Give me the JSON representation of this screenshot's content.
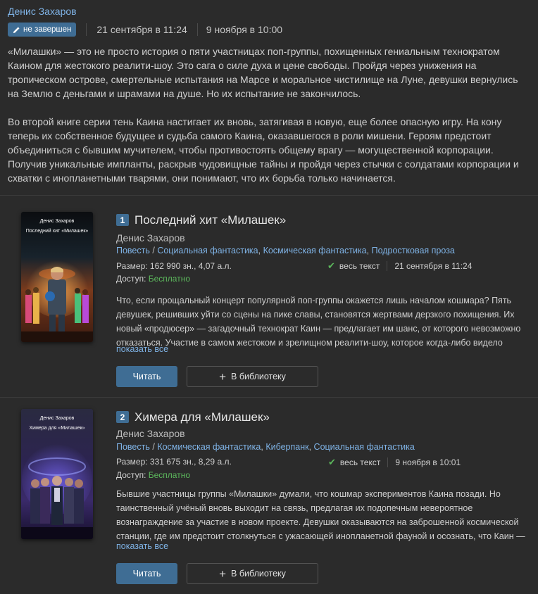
{
  "series": {
    "author": "Денис Захаров",
    "status_badge": "не завершен",
    "created": "21 сентября в 11:24",
    "updated": "9 ноября в 10:00",
    "description": [
      "«Милашки» — это не просто история о пяти участницах поп-группы, похищенных гениальным технократом Каином для жестокого реалити-шоу. Это сага о силе духа и цене свободы. Пройдя через унижения на тропическом острове, смертельные испытания на Марсе и моральное чистилище на Луне, девушки вернулись на Землю с деньгами и шрамами на душе. Но их испытание не закончилось.",
      "Во второй книге серии тень Каина настигает их вновь, затягивая в новую, еще более опасную игру. На кону теперь их собственное будущее и судьба самого Каина, оказавшегося в роли мишени. Героям предстоит объединиться с бывшим мучителем, чтобы противостоять общему врагу — могущественной корпорации. Получив уникальные импланты, раскрыв чудовищные тайны и пройдя через стычки с солдатами корпорации и схватки с инопланетными тварями, они понимают, что их борьба только начинается."
    ]
  },
  "books": [
    {
      "number": "1",
      "title": "Последний хит «Милашек»",
      "author": "Денис Захаров",
      "form": "Повесть",
      "genres": [
        "Социальная фантастика",
        "Космическая фантастика",
        "Подростковая проза"
      ],
      "size": "Размер: 162 990 зн., 4,07 а.л.",
      "text_status": "весь текст",
      "date": "21 сентября в 11:24",
      "access_label": "Доступ:",
      "access_value": "Бесплатно",
      "annotation": "Что, если прощальный концерт популярной поп-группы окажется лишь началом кошмара? Пять девушек, решивших уйти со сцены на пике славы, становятся жертвами дерзкого похищения. Их новый «продюсер» — загадочный технократ Каин — предлагает им шанс, от которого невозможно отказаться. Участие в самом жестоком и зрелищном реалити-шоу, которое когда-либо видело",
      "show_all": "показать все",
      "read_label": "Читать",
      "library_label": "В библиотеку",
      "cover_author": "Денис Захаров",
      "cover_title": "Последний хит «Милашек»"
    },
    {
      "number": "2",
      "title": "Химера для «Милашек»",
      "author": "Денис Захаров",
      "form": "Повесть",
      "genres": [
        "Космическая фантастика",
        "Киберпанк",
        "Социальная фантастика"
      ],
      "size": "Размер: 331 675 зн., 8,29 а.л.",
      "text_status": "весь текст",
      "date": "9 ноября в 10:01",
      "access_label": "Доступ:",
      "access_value": "Бесплатно",
      "annotation": "Бывшие участницы группы «Милашки» думали, что кошмар экспериментов Каина позади. Но таинственный учёный вновь выходит на связь, предлагая их подопечным невероятное вознаграждение за участие в новом проекте. Девушки оказываются на заброшенной космической станции, где им предстоит столкнуться с ужасающей инопланетной фауной и осознать, что Каин —",
      "show_all": "показать все",
      "read_label": "Читать",
      "library_label": "В библиотеку",
      "cover_author": "Денис Захаров",
      "cover_title": "Химера для «Милашек»"
    }
  ],
  "colors": {
    "background": "#2b2b2b",
    "accent": "#3f6d94",
    "link": "#7fb3e6",
    "success": "#5cb85c"
  }
}
